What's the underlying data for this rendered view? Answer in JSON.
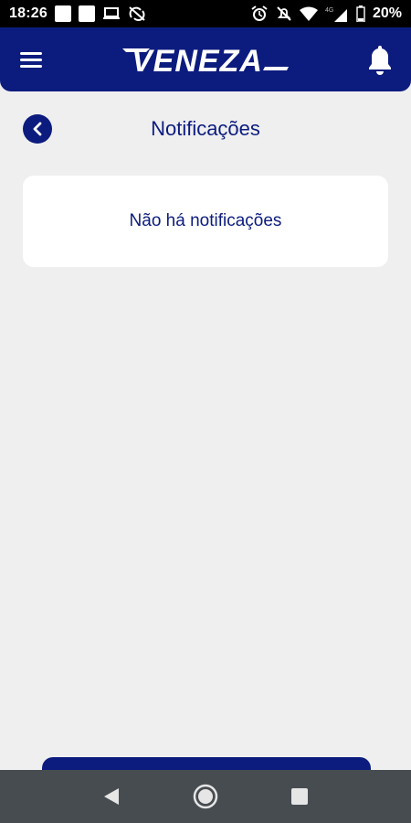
{
  "status_bar": {
    "time": "18:26",
    "battery": "20%",
    "network": "4G"
  },
  "app_bar": {
    "logo_text": "VENEZA",
    "icons": [
      "menu-icon",
      "bell-icon"
    ],
    "accent_color": "#0c1c7e"
  },
  "page": {
    "title": "Notificações",
    "empty_message": "Não há notificações"
  },
  "nav_bar": {
    "icons": [
      "back-triangle-icon",
      "home-circle-icon",
      "recents-square-icon"
    ]
  }
}
